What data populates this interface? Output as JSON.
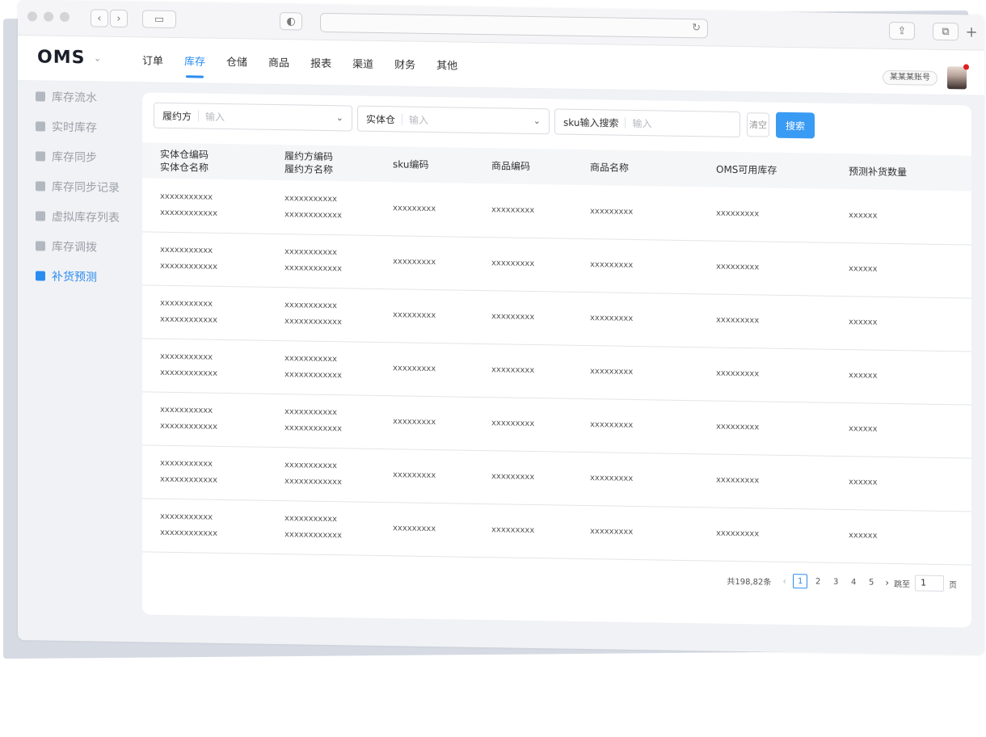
{
  "app": {
    "logo": "OMS",
    "account": "某某某账号"
  },
  "nav": {
    "items": [
      "订单",
      "库存",
      "仓储",
      "商品",
      "报表",
      "渠道",
      "财务",
      "其他"
    ],
    "active_index": 1
  },
  "sidebar": {
    "items": [
      {
        "label": "库存流水",
        "icon": "list-icon"
      },
      {
        "label": "实时库存",
        "icon": "stock-icon"
      },
      {
        "label": "库存同步",
        "icon": "sync-icon"
      },
      {
        "label": "库存同步记录",
        "icon": "sync-record-icon"
      },
      {
        "label": "虚拟库存列表",
        "icon": "virtual-list-icon"
      },
      {
        "label": "库存调拨",
        "icon": "transfer-icon"
      },
      {
        "label": "补货预测",
        "icon": "forecast-icon"
      }
    ],
    "active_index": 6
  },
  "filters": {
    "fulfiller": {
      "label": "履约方",
      "placeholder": "输入"
    },
    "warehouse": {
      "label": "实体仓",
      "placeholder": "输入"
    },
    "sku": {
      "label": "sku输入搜索",
      "placeholder": "输入"
    },
    "clear_label": "清空",
    "search_label": "搜索"
  },
  "table": {
    "headers": [
      [
        "实体仓编码",
        "实体仓名称"
      ],
      [
        "履约方编码",
        "履约方名称"
      ],
      [
        "sku编码"
      ],
      [
        "商品编码"
      ],
      [
        "商品名称"
      ],
      [
        "OMS可用库存"
      ],
      [
        "预测补货数量"
      ]
    ],
    "rows": [
      [
        [
          "xxxxxxxxxxx",
          "xxxxxxxxxxxx"
        ],
        [
          "xxxxxxxxxxx",
          "xxxxxxxxxxxx"
        ],
        [
          "xxxxxxxxx"
        ],
        [
          "xxxxxxxxx"
        ],
        [
          "xxxxxxxxx"
        ],
        [
          "xxxxxxxxx"
        ],
        [
          "xxxxxx"
        ]
      ],
      [
        [
          "xxxxxxxxxxx",
          "xxxxxxxxxxxx"
        ],
        [
          "xxxxxxxxxxx",
          "xxxxxxxxxxxx"
        ],
        [
          "xxxxxxxxx"
        ],
        [
          "xxxxxxxxx"
        ],
        [
          "xxxxxxxxx"
        ],
        [
          "xxxxxxxxx"
        ],
        [
          "xxxxxx"
        ]
      ],
      [
        [
          "xxxxxxxxxxx",
          "xxxxxxxxxxxx"
        ],
        [
          "xxxxxxxxxxx",
          "xxxxxxxxxxxx"
        ],
        [
          "xxxxxxxxx"
        ],
        [
          "xxxxxxxxx"
        ],
        [
          "xxxxxxxxx"
        ],
        [
          "xxxxxxxxx"
        ],
        [
          "xxxxxx"
        ]
      ],
      [
        [
          "xxxxxxxxxxx",
          "xxxxxxxxxxxx"
        ],
        [
          "xxxxxxxxxxx",
          "xxxxxxxxxxxx"
        ],
        [
          "xxxxxxxxx"
        ],
        [
          "xxxxxxxxx"
        ],
        [
          "xxxxxxxxx"
        ],
        [
          "xxxxxxxxx"
        ],
        [
          "xxxxxx"
        ]
      ],
      [
        [
          "xxxxxxxxxxx",
          "xxxxxxxxxxxx"
        ],
        [
          "xxxxxxxxxxx",
          "xxxxxxxxxxxx"
        ],
        [
          "xxxxxxxxx"
        ],
        [
          "xxxxxxxxx"
        ],
        [
          "xxxxxxxxx"
        ],
        [
          "xxxxxxxxx"
        ],
        [
          "xxxxxx"
        ]
      ],
      [
        [
          "xxxxxxxxxxx",
          "xxxxxxxxxxxx"
        ],
        [
          "xxxxxxxxxxx",
          "xxxxxxxxxxxx"
        ],
        [
          "xxxxxxxxx"
        ],
        [
          "xxxxxxxxx"
        ],
        [
          "xxxxxxxxx"
        ],
        [
          "xxxxxxxxx"
        ],
        [
          "xxxxxx"
        ]
      ],
      [
        [
          "xxxxxxxxxxx",
          "xxxxxxxxxxxx"
        ],
        [
          "xxxxxxxxxxx",
          "xxxxxxxxxxxx"
        ],
        [
          "xxxxxxxxx"
        ],
        [
          "xxxxxxxxx"
        ],
        [
          "xxxxxxxxx"
        ],
        [
          "xxxxxxxxx"
        ],
        [
          "xxxxxx"
        ]
      ]
    ]
  },
  "pagination": {
    "total": "共198,82条",
    "pages": [
      "1",
      "2",
      "3",
      "4",
      "5"
    ],
    "current": "1",
    "jump_label": "跳至",
    "jump_value": "1",
    "page_suffix": "页"
  },
  "colors": {
    "accent": "#2b8cf0",
    "button": "#3a9bf4"
  }
}
